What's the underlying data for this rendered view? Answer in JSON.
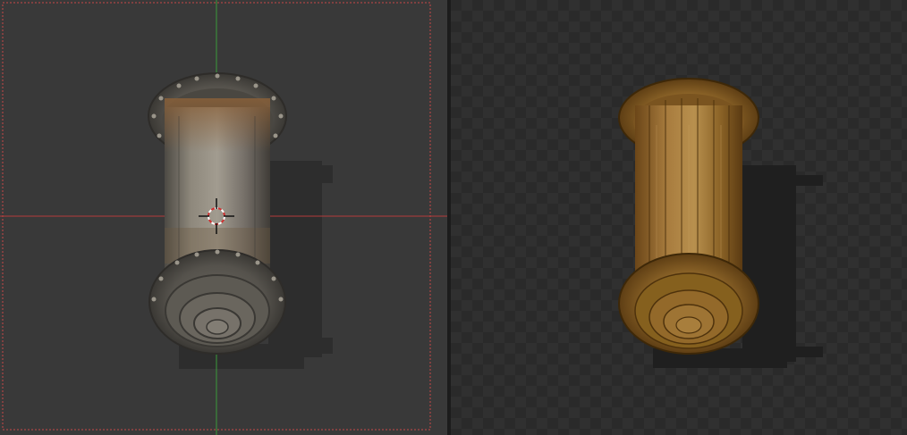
{
  "scene": {
    "left_viewport": {
      "object": "metal-pipe-barrel",
      "camera_frame": "dashed-red",
      "axes": {
        "x_axis_color": "#b53a3a",
        "y_axis_color": "#3a9a3a"
      },
      "cursor": "3d-cursor-icon"
    },
    "right_viewport": {
      "object": "wooden-barrel",
      "background": "transparency-checkerboard"
    }
  },
  "colors": {
    "viewport_bg": "#393939",
    "divider": "#1c1c1c",
    "checker_dark": "#2a2a2a",
    "checker_light": "#303030",
    "camera_frame": "#c84848",
    "metal_light": "#a09a8c",
    "metal_dark": "#4a4640",
    "rust": "#8a6038",
    "wood_light": "#b48a48",
    "wood_dark": "#5a3a14"
  }
}
